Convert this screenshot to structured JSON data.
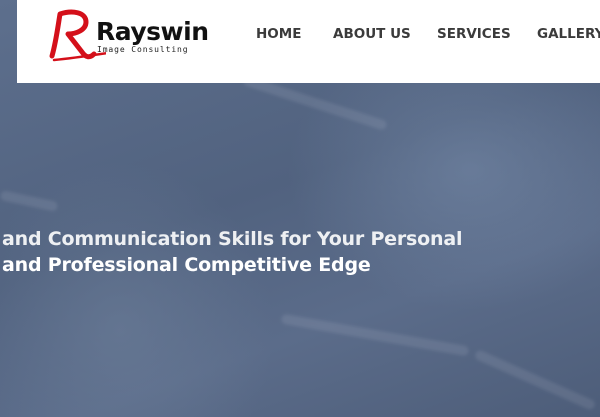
{
  "brand": {
    "name": "Rayswin",
    "tagline": "Image Consulting",
    "accent_color": "#d4101a"
  },
  "nav": {
    "items": [
      {
        "label": "HOME"
      },
      {
        "label": "ABOUT US"
      },
      {
        "label": "SERVICES"
      },
      {
        "label": "GALLERY"
      }
    ]
  },
  "hero": {
    "line1": "and Communication Skills for Your Personal",
    "line2": "and Professional Competitive Edge"
  }
}
